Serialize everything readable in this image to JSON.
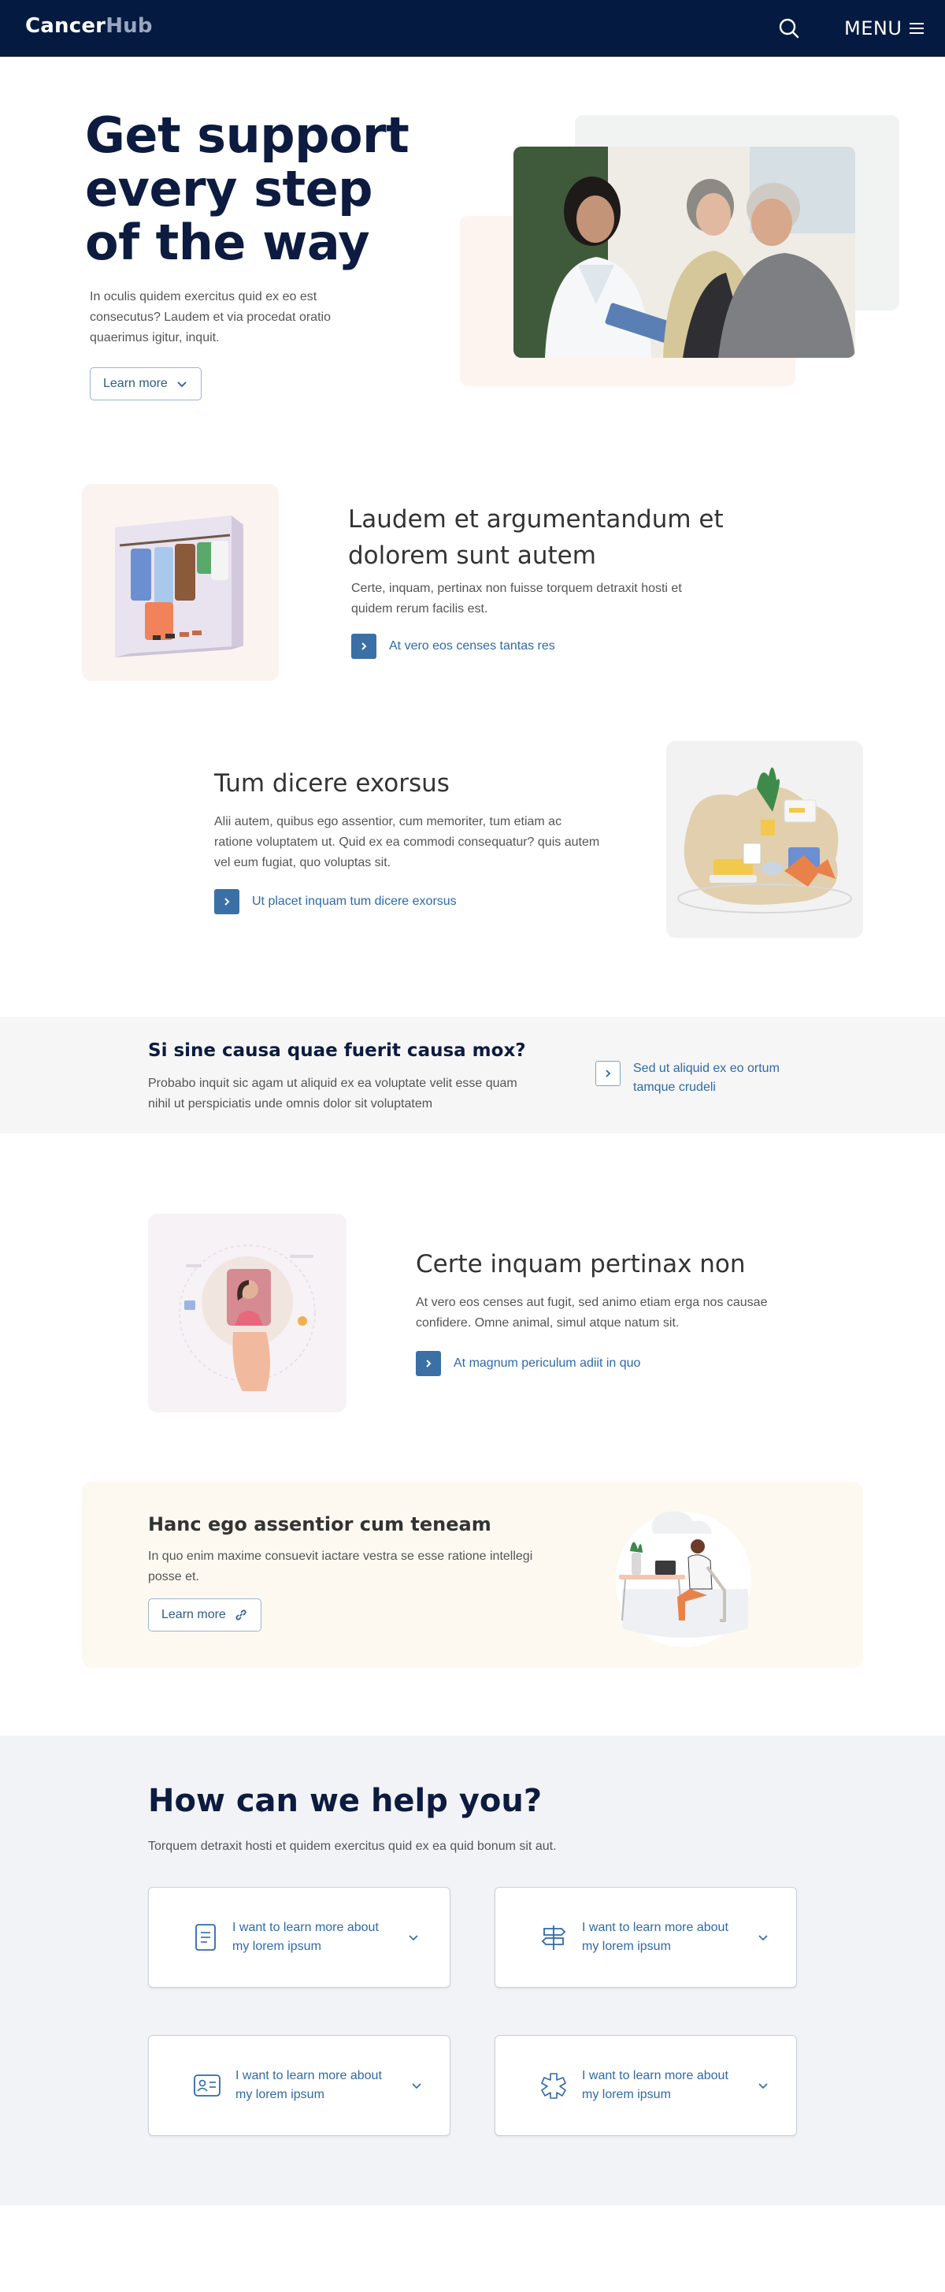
{
  "header": {
    "logo_part1": "Cancer",
    "logo_part2": "Hub",
    "menu_label": "MENU",
    "search_icon": "search-icon",
    "menu_icon": "hamburger-icon"
  },
  "hero": {
    "title_line1": "Get support",
    "title_line2": "every step",
    "title_line3": "of the way",
    "text": "In oculis quidem exercitus quid ex eo est consecutus? Laudem et via procedat oratio quaerimus igitur, inquit.",
    "button_label": "Learn more"
  },
  "feature1": {
    "title": "Laudem et argumentandum et dolorem sunt autem",
    "text": "Certe, inquam, pertinax non fuisse torquem detraxit hosti et quidem rerum facilis est.",
    "link": "At vero eos censes tantas res"
  },
  "feature2": {
    "title": "Tum dicere exorsus",
    "text": "Alii autem, quibus ego assentior, cum memoriter, tum etiam ac ratione voluptatem ut. Quid ex ea commodi consequatur? quis autem vel eum fugiat, quo voluptas sit.",
    "link": "Ut placet inquam tum dicere exorsus"
  },
  "band": {
    "title": "Si sine causa quae fuerit causa mox?",
    "text": "Probabo inquit sic agam ut aliquid ex ea voluptate velit esse quam nihil ut perspiciatis unde omnis dolor sit voluptatem",
    "link": "Sed ut aliquid ex eo ortum tamque crudeli"
  },
  "feature3": {
    "title": "Certe inquam pertinax non",
    "text": "At vero eos censes aut fugit, sed animo etiam erga nos causae confidere. Omne animal, simul atque natum sit.",
    "link": "At magnum periculum adiit in quo"
  },
  "callout": {
    "title": "Hanc ego assentior cum teneam",
    "text": "In quo enim maxime consuevit iactare vestra se esse ratione intellegi posse et.",
    "button_label": "Learn more"
  },
  "help": {
    "title": "How can we help you?",
    "subtitle": "Torquem detraxit hosti et quidem exercitus quid ex ea quid bonum sit aut.",
    "cards": [
      {
        "label": "I want to learn more about my lorem ipsum",
        "icon": "document-icon"
      },
      {
        "label": "I want to learn more about my lorem ipsum",
        "icon": "signpost-icon"
      },
      {
        "label": "I want to learn more about my lorem ipsum",
        "icon": "id-card-icon"
      },
      {
        "label": "I want to learn more about my lorem ipsum",
        "icon": "puzzle-icon"
      }
    ]
  },
  "colors": {
    "navy": "#051a40",
    "heading": "#0c1b3f",
    "link": "#2e6aa8",
    "accent_button": "#3a70a5"
  }
}
